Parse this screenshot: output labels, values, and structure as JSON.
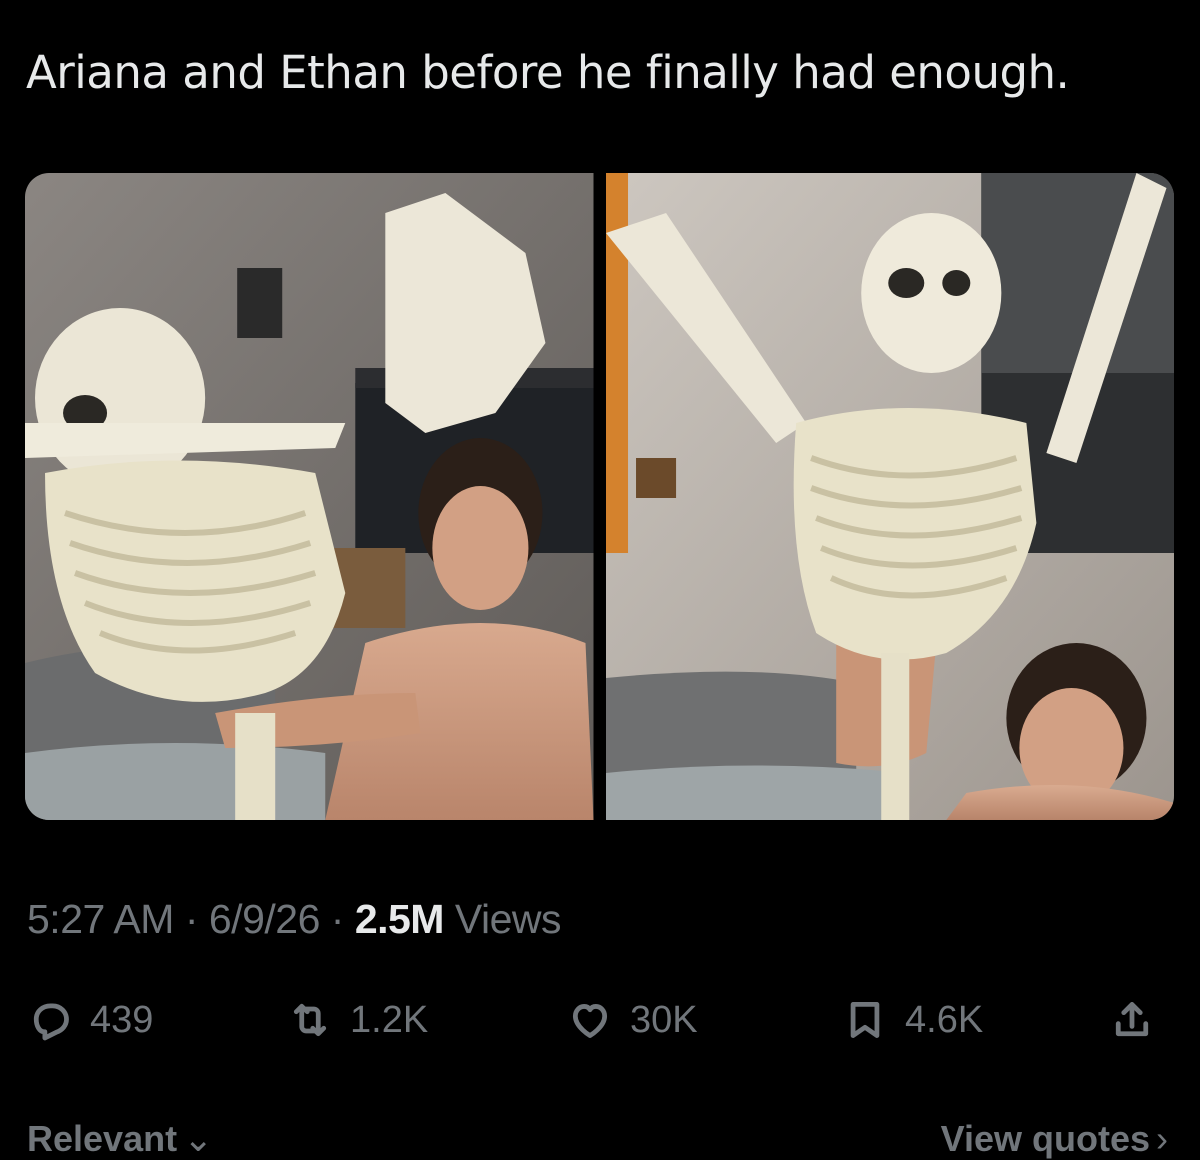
{
  "tweet": {
    "text": "Ariana and Ethan before he finally had enough."
  },
  "media": [
    {
      "name": "photo-1",
      "description_icon": "photo"
    },
    {
      "name": "photo-2",
      "description_icon": "photo"
    }
  ],
  "meta": {
    "time": "5:27 AM",
    "sep1": " · ",
    "date": "6/9/26",
    "sep2": " · ",
    "views_count": "2.5M",
    "views_label": " Views"
  },
  "actions": {
    "replies": {
      "icon": "reply-icon",
      "count": "439"
    },
    "reposts": {
      "icon": "repost-icon",
      "count": "1.2K"
    },
    "likes": {
      "icon": "heart-icon",
      "count": "30K"
    },
    "bookmarks": {
      "icon": "bookmark-icon",
      "count": "4.6K"
    },
    "share": {
      "icon": "share-icon"
    }
  },
  "footer": {
    "sort_label": "Relevant",
    "quotes_label": "View quotes"
  },
  "colors": {
    "background": "#000000",
    "text_primary": "#e7e9ea",
    "text_secondary": "#71767b"
  }
}
